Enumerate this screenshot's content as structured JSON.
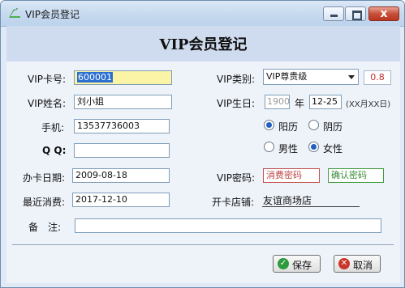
{
  "window": {
    "title": "VIP会员登记",
    "close_glyph": "x"
  },
  "header": {
    "title": "VIP会员登记"
  },
  "labels": {
    "card_no": "VIP卡号:",
    "name": "VIP姓名:",
    "phone": "手机:",
    "qq": "Q Q:",
    "open_date": "办卡日期:",
    "last_spend": "最近消费:",
    "remark": "备　注:",
    "vip_type": "VIP类别:",
    "birthday": "VIP生日:",
    "year_unit": "年",
    "date_format": "(XX月XX日)",
    "password": "VIP密码:",
    "store": "开卡店铺:"
  },
  "fields": {
    "card_no": "600001",
    "name": "刘小姐",
    "phone": "13537736003",
    "qq": "",
    "open_date": "2009-08-18",
    "last_spend": "2017-12-10",
    "remark": "",
    "vip_type": "VIP尊贵级",
    "discount": "0.8",
    "birth_year": "1900",
    "birth_md": "12-25",
    "password_placeholder": "消费密码",
    "confirm_placeholder": "确认密码",
    "store": "友谊商场店"
  },
  "radios": {
    "solar": "阳历",
    "lunar": "阴历",
    "male": "男性",
    "female": "女性",
    "calendar_selected": "solar",
    "gender_selected": "female"
  },
  "buttons": {
    "save": "保存",
    "cancel": "取消"
  },
  "icons": {
    "app": "app-logo-icon",
    "save": "check-icon",
    "cancel": "x-icon"
  },
  "colors": {
    "header_bg": "#cfdbee",
    "focus_bg": "#fbf3a6",
    "discount": "#c03030"
  }
}
